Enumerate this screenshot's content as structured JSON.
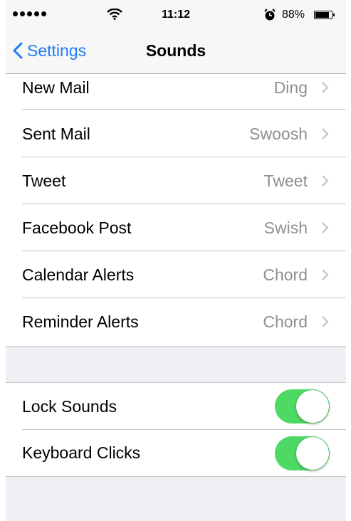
{
  "status_bar": {
    "time": "11:12",
    "battery_percent": "88%",
    "battery_level": 0.88,
    "icons": [
      "signal-dots-icon",
      "wifi-icon",
      "alarm-icon",
      "battery-icon"
    ]
  },
  "nav": {
    "back_label": "Settings",
    "title": "Sounds",
    "accent_color": "#1a7cf5"
  },
  "sounds": [
    {
      "label": "New Mail",
      "value": "Ding"
    },
    {
      "label": "Sent Mail",
      "value": "Swoosh"
    },
    {
      "label": "Tweet",
      "value": "Tweet"
    },
    {
      "label": "Facebook Post",
      "value": "Swish"
    },
    {
      "label": "Calendar Alerts",
      "value": "Chord"
    },
    {
      "label": "Reminder Alerts",
      "value": "Chord"
    }
  ],
  "toggles": [
    {
      "label": "Lock Sounds",
      "on": true
    },
    {
      "label": "Keyboard Clicks",
      "on": true
    }
  ],
  "colors": {
    "toggle_on": "#4cd964",
    "secondary_text": "#8e8e93",
    "grouped_background": "#efeff4"
  }
}
